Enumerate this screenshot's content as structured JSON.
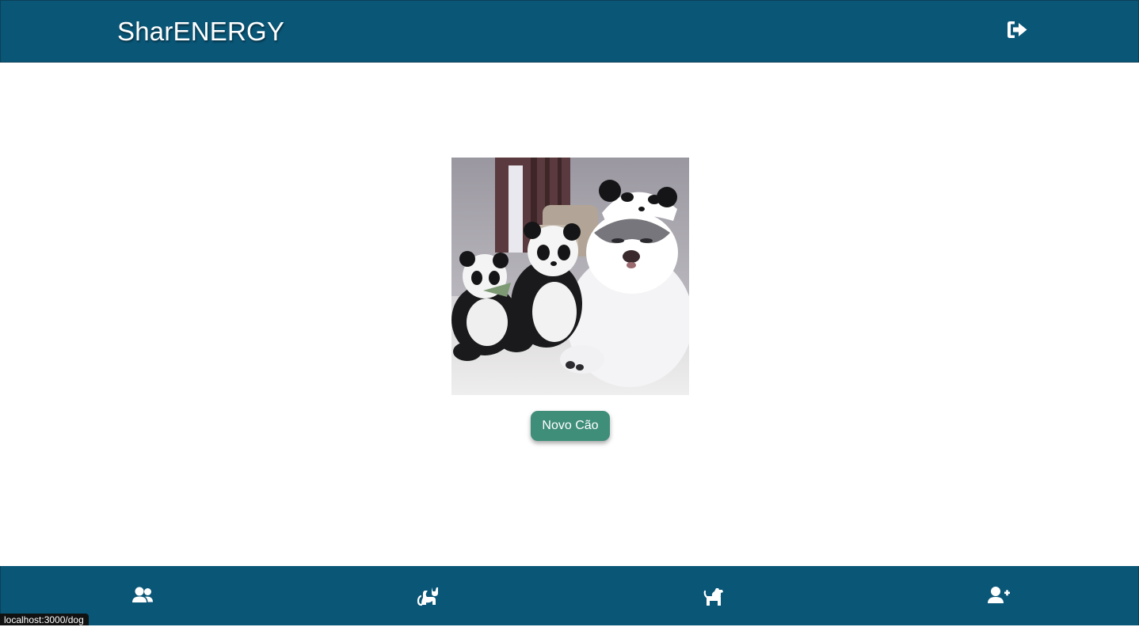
{
  "header": {
    "brand": "SharENERGY",
    "logout_icon": "sign-out-icon"
  },
  "main": {
    "photo_icon": "dog-photo",
    "new_dog_button": "Novo Cão"
  },
  "footer": {
    "items": [
      {
        "icon": "users-icon"
      },
      {
        "icon": "cat-icon"
      },
      {
        "icon": "dog-icon"
      },
      {
        "icon": "user-plus-icon"
      }
    ]
  },
  "status_bar": {
    "url": "localhost:3000/dog"
  },
  "colors": {
    "bar_background": "#0a5677",
    "button_background": "#3f8e7a",
    "text_on_dark": "#ffffff"
  }
}
